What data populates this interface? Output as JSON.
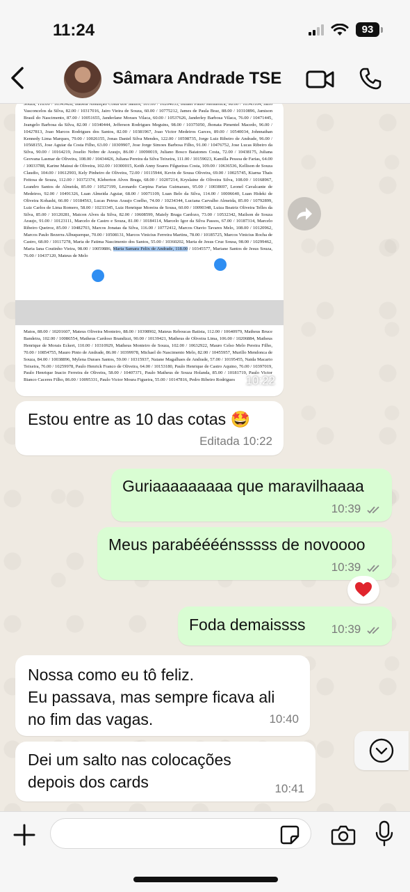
{
  "status": {
    "time": "11:24",
    "battery": "93"
  },
  "header": {
    "contact_name": "Sâmara Andrade TSE"
  },
  "image_message": {
    "time": "10:22",
    "page1_text": "Souza, 118.00 / 10345428, Isabela Assunção Costa dos Santos, 101.00 / 10264633, Ismael Paulo Mendonca, 98.00 / 10345104, Jairo Vasconcelos da Silva, 82.00 / 10317016, Jairo Vieira de Souza, 60.00 / 10775212, James de Paula Braz, 88.00 / 10310896, Jamison Brasil do Nascimento, 87.00 / 10051655, Janderlane Moraes Vilaca, 60.00 / 10537626, Janderley Barbosa Vilaca, 76.00 / 10471445, Jeangelo Barbosa da Silva, 82.00 / 10340444, Jefferson Rodrigues Meguins, 98.00 / 10375050, Jhonata Pimentel Macedo, 96.00 / 10427813, Joao Marcos Rodrigues dos Santos, 82.00 / 10381967, Joao Victor Medeiros Garces, 89.00 / 10540034, Johnnathan Kennedy Lima Marques, 79.00 / 10026155, Jonas Daniel Silva Mendes, 122.00 / 10598735, Jorge Luiz Ribeiro de Andrade, 96.00 / 10568155, Jose Aguiar da Costa Filho, 63.00 / 10309907, Jose Jorge Simoes Barbosa Filho, 91.00 / 10476752, Jose Lucas Ribeiro da Silva, 90.00 / 10164219, Joselio Nobre de Araujo, 86.00 / 10090019, Juliano Bosco Baiatones Costa, 72.00 / 10438175, Juliana Geovana Lasmar de Oliveira, 108.00 / 10434426, Juliana Pereira da Silva Teixeira, 111.00 / 10159023, Kamilla Pessoa de Farias, 64.00 / 10033788, Karine Matsui de Oliveira, 102.00 / 10300015, Keith Anny Soares Filgueiras Costa, 109.00 / 10636536, Kellison de Souza Claudio, 104.00 / 10612903, Kely Pinheiro de Oliveira, 72.00 / 10115944, Kevin de Sousa Oliveira, 69.00 / 10025745, Kiarna Thais Feitosa de Souza, 112.00 / 10372374, Kleberton Alves Braga, 68.00 / 10207214, Kryslaine de Oliveira Silva, 108.00 / 10168967, Leandro Santos de Almeida, 85.00 / 10527199, Leonardo Carpina Farias Guimaraes, 95.00 / 10038697, Leonel Cavalcante de Medeiros, 92.00 / 10491326, Luan Almeida Aguiar, 68.00 / 10071109, Luan Belo da Silva, 114.00 / 10006640, Luan Hideki de Oliveira Kohashi, 66.00 / 10184563, Lucas Petrus Araujo Coelho, 74.00 / 10234344, Luciana Carvalho Almeida, 85.00 / 10792899, Luiz Carlos de Lima Romero, 58.00 / 10233345, Luiz Henrique Moreira de Sousa, 60.00 / 10090348, Luiza Beatriz Oliveira Telles da Silva, 85.00 / 10120281, Maicon Alves da Silva, 82.00 / 10608599, Maiely Braga Cardozo, 73.00 / 10532342, Mailson de Souza Araujo, 91.00 / 10123111, Marcelo de Castro e Souza, 81.00 / 10184114, Marcelo Igor da Silva Passos, 67.00 / 10187314, Marcelo Ribeiro Queiroz, 85.00 / 10482703, Marcos Jonatas da Silva, 116.00 / 10772412, Marcos Otavio Tavares Melo, 108.00 / 10120962, Marcos Paulo Bezerra Albuquerque, 70.00 / 10508131, Marcos Vinicius Ferreira Martins, 78.00 / 10185725, Marcos Vinicius Rocha de Castro, 68.00 / 10117278, Maria de Fatima Nascimento dos Santos, 55.00 / 10360202, Maria de Jesus Cruz Sousa, 98.00 / 10299462, Maria Iana Coutinho Vieira, 98.00 / 10059886, ",
    "highlight_text": "Maria Samara Felix de Andrade, 118.00",
    "page1_tail": " / 10345577, Mariane Santos de Jesus Souza, 76.00 / 10437120, Mateus de Melo",
    "page2_text": "Matos, 88.00 / 10201607, Mateus Oliveira Monteiro, 88.00 / 10398902, Mateus Reboucas Batista, 112.00 / 10640979, Matheus Bruce Bandeira, 102.00 / 10086554, Matheus Cardoso Brandizzi, 90.00 / 10139421, Matheus de Oliveira Lima, 106.00 / 10206884, Matheus Henrique de Morais Eckert, 110.00 / 10310929, Matheus Monteiro de Souza, 102.00 / 10632922, Mauro Celso Melo Pereira Filho, 70.00 / 10854755, Mauro Pinto de Andrade, 86.00 / 10399978, Michael do Nascimento Melo, 82.00 / 10455957, Murillo Mendonca de Souza, 84.00 / 10038896, Mylena Duraes Santos, 59.00 / 10315937, Naiane Magalhaes de Andrade, 57.00 / 10195455, Naida Macario Teixeira, 76.00 / 10259978, Paulo Henrick Franco de Oliveira, 64.00 / 10153180, Paulo Henrique de Castro Aquino, 76.00 / 10397019, Paulo Henrique Inacio Ferreira de Oliveira, 58.00 / 10407371, Paulo Matheus de Souza Holanda, 85.00 / 10181719, Paulo Victor Bianco Caceres Filho, 86.00 / 10095331, Paulo Victor Moura Figueira, 55.00 / 10147816, Pedro Ribeiro Rodrigues"
  },
  "messages": [
    {
      "dir": "in",
      "text": "Estou entre as 10 das cotas 🤩",
      "meta": "Editada 10:22"
    },
    {
      "dir": "out",
      "text": "Guriaaaaaaaaa que maravilhaaaa",
      "meta": "10:39"
    },
    {
      "dir": "out",
      "text": "Meus parabéééénsssss de novoooo",
      "meta": "10:39",
      "reaction": "❤️"
    },
    {
      "dir": "out",
      "text": "Foda demaissss",
      "meta": "10:39"
    },
    {
      "dir": "in",
      "text_lines": [
        "Nossa como eu tô feliz.",
        "Eu passava, mas sempre ficava ali",
        "no fim das vagas."
      ],
      "meta": "10:40"
    },
    {
      "dir": "in",
      "text_lines": [
        "Dei um salto nas colocações",
        "depois dos cards"
      ],
      "meta": "10:41"
    }
  ],
  "colors": {
    "outgoing": "#d9fdd3",
    "incoming": "#ffffff",
    "chat_bg": "#efeae2",
    "ticks": "#8a8a8a"
  },
  "icons": [
    "back-chevron-icon",
    "video-camera-icon",
    "phone-icon",
    "forward-arrow-icon",
    "double-check-icon",
    "chevron-down-icon",
    "plus-icon",
    "sticker-icon",
    "camera-icon",
    "microphone-icon"
  ]
}
